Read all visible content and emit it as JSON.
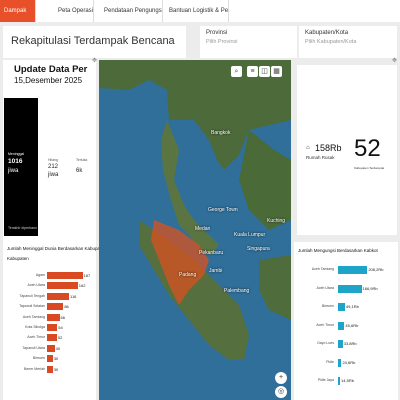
{
  "tabs": [
    "Dampak",
    "Peta Operasi",
    "Pendataan Pengungsi Terpi",
    "Bantuan Logistik & Peralatan"
  ],
  "header": {
    "title": "Rekapitulasi Terdampak Bencana",
    "provinsi_label": "Provinsi",
    "provinsi_placeholder": "Pilih Provinsi",
    "kabupaten_label": "Kabupaten/Kota",
    "kabupaten_placeholder": "Pilih Kabupaten/Kota"
  },
  "update": {
    "title": "Update Data Per",
    "date": "15,Desember 2025"
  },
  "stats": {
    "meninggal_label": "Meninggal",
    "meninggal_value": "1016",
    "meninggal_unit": "jiwa",
    "hilang_label": "Hilang",
    "hilang_value": "212",
    "hilang_unit": "jiwa",
    "terluka_label": "Terluka",
    "terluka_value": "6k",
    "footer": "Terakhir diperbarui"
  },
  "kpi": {
    "rumah_value": "158Rb",
    "rumah_label": "Rumah Rusak",
    "kab_value": "52",
    "kab_label": "Kabupaten Terdampak"
  },
  "map_labels": [
    "Bangkok",
    "George Town",
    "Kuala Lumpur",
    "Singapura",
    "Medan",
    "Padang",
    "Palembang",
    "Jambi",
    "Pekanbaru",
    "Kuching"
  ],
  "colors": {
    "tab_active": "#e8502a",
    "bar_left": "#d94a23",
    "bar_right": "#1ea3c9",
    "black_card": "#000000"
  },
  "chart_data": [
    {
      "type": "bar",
      "title": "Jumlah Meninggal Dunia Berdasarkan Kabupaten",
      "subtitle": "Kabupaten",
      "categories": [
        "Agam",
        "Aceh Utara",
        "Tapanuli Tengah",
        "Tapanuli Selatan",
        "Aceh Tamiang",
        "Kota Sibolga",
        "Aceh Timur",
        "Tapanuli Utara",
        "Bireuen",
        "Bener Meriah"
      ],
      "values": [
        187,
        162,
        116,
        86,
        66,
        54,
        52,
        40,
        30,
        30
      ],
      "value_labels": [
        "187",
        "162",
        "116",
        "86",
        "66",
        "54",
        "52",
        "40",
        "30",
        "30"
      ]
    },
    {
      "type": "bar",
      "title": "Jumlah Mengungsi Berdasarkan Kabkot",
      "categories": [
        "Aceh Tamiang",
        "Aceh Utara",
        "Bireuen",
        "Aceh Timur",
        "Gayo Lues",
        "Pidie",
        "Pidie Jaya"
      ],
      "values": [
        208.2,
        166.9,
        49.1,
        45.6,
        33.8,
        24.6,
        14.5
      ],
      "value_labels": [
        "208,2Rb",
        "166,9Rb",
        "49,1Rb",
        "45,6Rb",
        "33,8Rb",
        "24,6Rb",
        "14,5Rb"
      ]
    }
  ]
}
